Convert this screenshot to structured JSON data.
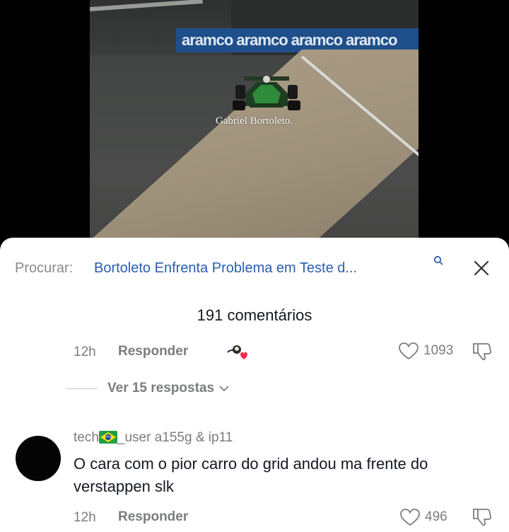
{
  "video": {
    "caption": "Gabriel Bortoleto.",
    "banner_text": "aramco  aramco  aramco  aramco"
  },
  "search": {
    "prefix": "Procurar:",
    "query": "Bortoleto Enfrenta Problema em Teste d..."
  },
  "comments_header": {
    "count_label": "191 comentários"
  },
  "comment_1": {
    "time": "12h",
    "reply_label": "Responder",
    "like_count": "1093",
    "view_replies_label": "Ver 15 respostas"
  },
  "comment_2": {
    "username_before": "tech",
    "username_after": "_user a155g & ip11",
    "text": "O cara com o pior carro do grid andou ma frente do verstappen slk",
    "time": "12h",
    "reply_label": "Responder",
    "like_count": "496"
  },
  "icons": {
    "search": "search-icon",
    "close": "close-icon",
    "heart": "heart-icon",
    "dislike": "thumbs-down-icon",
    "chevron": "chevron-down-icon",
    "flag": "brazil-flag-icon"
  },
  "colors": {
    "link_blue": "#2a5db0",
    "muted_text": "#7b7c80",
    "primary_text": "#161823",
    "creator_heart": "#fe2c55"
  }
}
